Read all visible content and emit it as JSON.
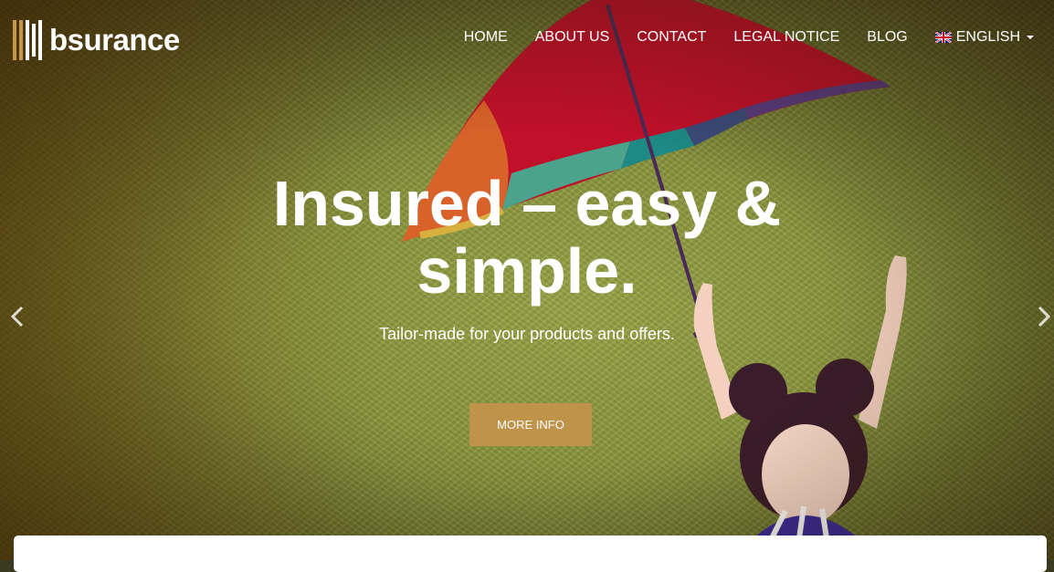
{
  "brand": {
    "name": "bsurance",
    "logo_icon": "bars-logo-icon",
    "accent_color": "#c0934a"
  },
  "nav": {
    "items": [
      {
        "label": "HOME"
      },
      {
        "label": "ABOUT US"
      },
      {
        "label": "CONTACT"
      },
      {
        "label": "LEGAL NOTICE"
      },
      {
        "label": "BLOG"
      }
    ],
    "language": {
      "label": "ENGLISH",
      "icon": "uk-flag-icon"
    }
  },
  "hero": {
    "headline_line1": "Insured – easy &",
    "headline_line2": "simple.",
    "subtitle": "Tailor-made for your products and offers.",
    "cta_label": "MORE INFO",
    "prev_icon": "chevron-left-icon",
    "next_icon": "chevron-right-icon"
  }
}
